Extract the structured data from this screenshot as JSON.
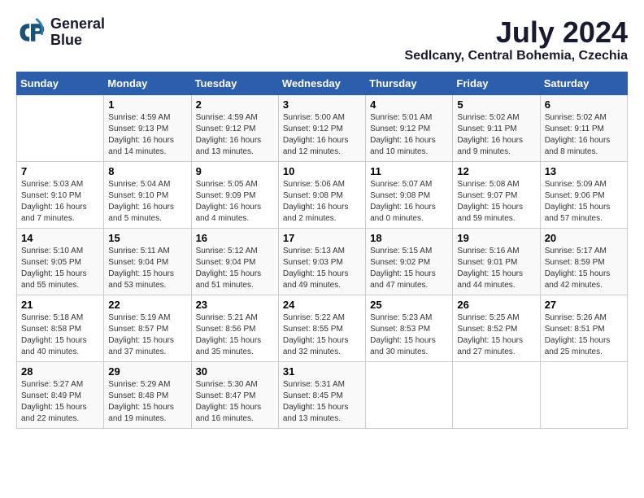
{
  "header": {
    "logo_line1": "General",
    "logo_line2": "Blue",
    "month_year": "July 2024",
    "location": "Sedlcany, Central Bohemia, Czechia"
  },
  "days_of_week": [
    "Sunday",
    "Monday",
    "Tuesday",
    "Wednesday",
    "Thursday",
    "Friday",
    "Saturday"
  ],
  "weeks": [
    [
      {
        "day": "",
        "info": ""
      },
      {
        "day": "1",
        "info": "Sunrise: 4:59 AM\nSunset: 9:13 PM\nDaylight: 16 hours\nand 14 minutes."
      },
      {
        "day": "2",
        "info": "Sunrise: 4:59 AM\nSunset: 9:12 PM\nDaylight: 16 hours\nand 13 minutes."
      },
      {
        "day": "3",
        "info": "Sunrise: 5:00 AM\nSunset: 9:12 PM\nDaylight: 16 hours\nand 12 minutes."
      },
      {
        "day": "4",
        "info": "Sunrise: 5:01 AM\nSunset: 9:12 PM\nDaylight: 16 hours\nand 10 minutes."
      },
      {
        "day": "5",
        "info": "Sunrise: 5:02 AM\nSunset: 9:11 PM\nDaylight: 16 hours\nand 9 minutes."
      },
      {
        "day": "6",
        "info": "Sunrise: 5:02 AM\nSunset: 9:11 PM\nDaylight: 16 hours\nand 8 minutes."
      }
    ],
    [
      {
        "day": "7",
        "info": "Sunrise: 5:03 AM\nSunset: 9:10 PM\nDaylight: 16 hours\nand 7 minutes."
      },
      {
        "day": "8",
        "info": "Sunrise: 5:04 AM\nSunset: 9:10 PM\nDaylight: 16 hours\nand 5 minutes."
      },
      {
        "day": "9",
        "info": "Sunrise: 5:05 AM\nSunset: 9:09 PM\nDaylight: 16 hours\nand 4 minutes."
      },
      {
        "day": "10",
        "info": "Sunrise: 5:06 AM\nSunset: 9:08 PM\nDaylight: 16 hours\nand 2 minutes."
      },
      {
        "day": "11",
        "info": "Sunrise: 5:07 AM\nSunset: 9:08 PM\nDaylight: 16 hours\nand 0 minutes."
      },
      {
        "day": "12",
        "info": "Sunrise: 5:08 AM\nSunset: 9:07 PM\nDaylight: 15 hours\nand 59 minutes."
      },
      {
        "day": "13",
        "info": "Sunrise: 5:09 AM\nSunset: 9:06 PM\nDaylight: 15 hours\nand 57 minutes."
      }
    ],
    [
      {
        "day": "14",
        "info": "Sunrise: 5:10 AM\nSunset: 9:05 PM\nDaylight: 15 hours\nand 55 minutes."
      },
      {
        "day": "15",
        "info": "Sunrise: 5:11 AM\nSunset: 9:04 PM\nDaylight: 15 hours\nand 53 minutes."
      },
      {
        "day": "16",
        "info": "Sunrise: 5:12 AM\nSunset: 9:04 PM\nDaylight: 15 hours\nand 51 minutes."
      },
      {
        "day": "17",
        "info": "Sunrise: 5:13 AM\nSunset: 9:03 PM\nDaylight: 15 hours\nand 49 minutes."
      },
      {
        "day": "18",
        "info": "Sunrise: 5:15 AM\nSunset: 9:02 PM\nDaylight: 15 hours\nand 47 minutes."
      },
      {
        "day": "19",
        "info": "Sunrise: 5:16 AM\nSunset: 9:01 PM\nDaylight: 15 hours\nand 44 minutes."
      },
      {
        "day": "20",
        "info": "Sunrise: 5:17 AM\nSunset: 8:59 PM\nDaylight: 15 hours\nand 42 minutes."
      }
    ],
    [
      {
        "day": "21",
        "info": "Sunrise: 5:18 AM\nSunset: 8:58 PM\nDaylight: 15 hours\nand 40 minutes."
      },
      {
        "day": "22",
        "info": "Sunrise: 5:19 AM\nSunset: 8:57 PM\nDaylight: 15 hours\nand 37 minutes."
      },
      {
        "day": "23",
        "info": "Sunrise: 5:21 AM\nSunset: 8:56 PM\nDaylight: 15 hours\nand 35 minutes."
      },
      {
        "day": "24",
        "info": "Sunrise: 5:22 AM\nSunset: 8:55 PM\nDaylight: 15 hours\nand 32 minutes."
      },
      {
        "day": "25",
        "info": "Sunrise: 5:23 AM\nSunset: 8:53 PM\nDaylight: 15 hours\nand 30 minutes."
      },
      {
        "day": "26",
        "info": "Sunrise: 5:25 AM\nSunset: 8:52 PM\nDaylight: 15 hours\nand 27 minutes."
      },
      {
        "day": "27",
        "info": "Sunrise: 5:26 AM\nSunset: 8:51 PM\nDaylight: 15 hours\nand 25 minutes."
      }
    ],
    [
      {
        "day": "28",
        "info": "Sunrise: 5:27 AM\nSunset: 8:49 PM\nDaylight: 15 hours\nand 22 minutes."
      },
      {
        "day": "29",
        "info": "Sunrise: 5:29 AM\nSunset: 8:48 PM\nDaylight: 15 hours\nand 19 minutes."
      },
      {
        "day": "30",
        "info": "Sunrise: 5:30 AM\nSunset: 8:47 PM\nDaylight: 15 hours\nand 16 minutes."
      },
      {
        "day": "31",
        "info": "Sunrise: 5:31 AM\nSunset: 8:45 PM\nDaylight: 15 hours\nand 13 minutes."
      },
      {
        "day": "",
        "info": ""
      },
      {
        "day": "",
        "info": ""
      },
      {
        "day": "",
        "info": ""
      }
    ]
  ]
}
